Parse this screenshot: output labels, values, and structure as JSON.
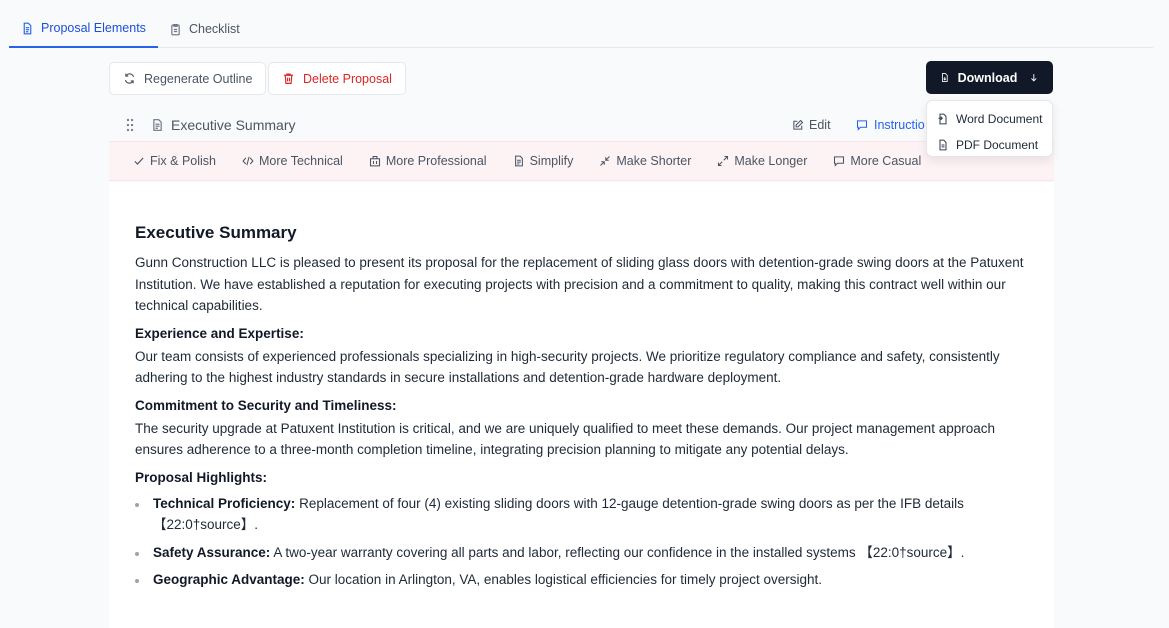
{
  "tabs": [
    {
      "label": "Proposal Elements",
      "active": true
    },
    {
      "label": "Checklist",
      "active": false
    }
  ],
  "actions": {
    "regenerate_label": "Regenerate Outline",
    "delete_label": "Delete Proposal",
    "download_label": "Download"
  },
  "download_menu": [
    {
      "label": "Word Document",
      "icon": "word-doc-icon"
    },
    {
      "label": "PDF Document",
      "icon": "pdf-doc-icon"
    }
  ],
  "section": {
    "title": "Executive Summary",
    "edit_label": "Edit",
    "instructions_label": "Instructio"
  },
  "toolbar": [
    {
      "label": "Fix & Polish",
      "icon": "check-icon"
    },
    {
      "label": "More Technical",
      "icon": "code-icon"
    },
    {
      "label": "More Professional",
      "icon": "building-icon"
    },
    {
      "label": "Simplify",
      "icon": "document-icon"
    },
    {
      "label": "Make Shorter",
      "icon": "shrink-icon"
    },
    {
      "label": "Make Longer",
      "icon": "expand-icon"
    },
    {
      "label": "More Casual",
      "icon": "chat-icon"
    }
  ],
  "doc": {
    "heading": "Executive Summary",
    "intro": "Gunn Construction LLC is pleased to present its proposal for the replacement of sliding glass doors with detention-grade swing doors at the Patuxent Institution. We have established a reputation for executing projects with precision and a commitment to quality, making this contract well within our technical capabilities.",
    "h_experience": "Experience and Expertise:",
    "p_experience": "Our team consists of experienced professionals specializing in high-security projects. We prioritize regulatory compliance and safety, consistently adhering to the highest industry standards in secure installations and detention-grade hardware deployment.",
    "h_commitment": "Commitment to Security and Timeliness:",
    "p_commitment": "The security upgrade at Patuxent Institution is critical, and we are uniquely qualified to meet these demands. Our project management approach ensures adherence to a three-month completion timeline, integrating precision planning to mitigate any potential delays.",
    "h_highlights": "Proposal Highlights:",
    "highlights": [
      {
        "title": "Technical Proficiency:",
        "text": " Replacement of four (4) existing sliding doors with 12-gauge detention-grade swing doors as per the IFB details 【22:0†source】."
      },
      {
        "title": "Safety Assurance:",
        "text": " A two-year warranty covering all parts and labor, reflecting our confidence in the installed systems 【22:0†source】."
      },
      {
        "title": "Geographic Advantage:",
        "text": " Our location in Arlington, VA, enables logistical efficiencies for timely project oversight."
      }
    ]
  }
}
